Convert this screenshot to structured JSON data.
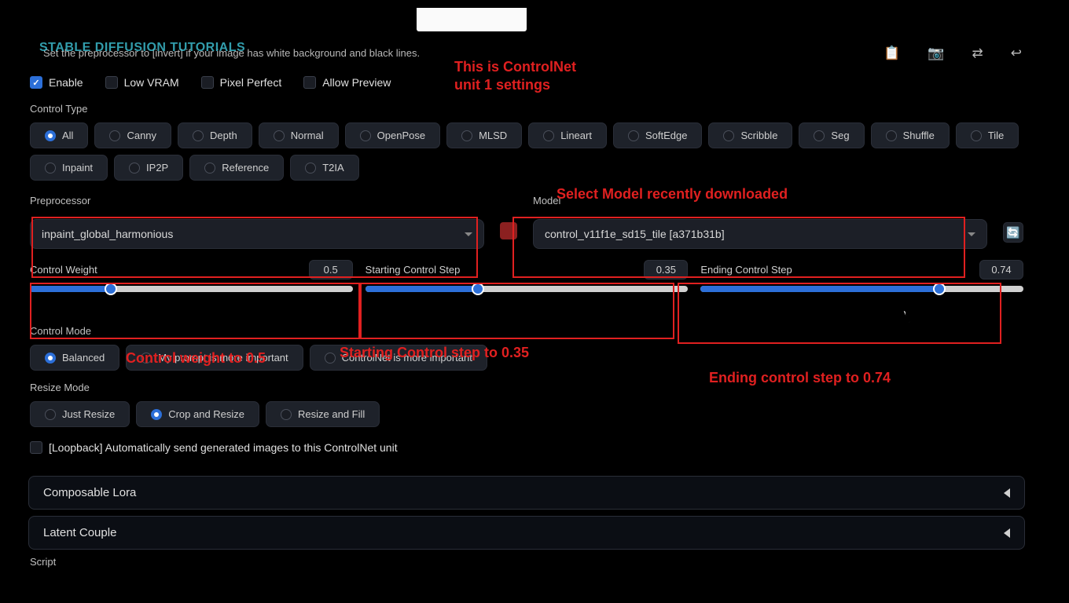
{
  "watermark": "STABLE DIFFUSION TUTORIALS",
  "instruction_text": "Set the preprocessor to [invert] if your image has white background and black lines.",
  "checkboxes": {
    "enable": "Enable",
    "low_vram": "Low VRAM",
    "pixel_perfect": "Pixel Perfect",
    "allow_preview": "Allow Preview"
  },
  "control_type": {
    "label": "Control Type",
    "options": [
      "All",
      "Canny",
      "Depth",
      "Normal",
      "OpenPose",
      "MLSD",
      "Lineart",
      "SoftEdge",
      "Scribble",
      "Seg",
      "Shuffle",
      "Tile",
      "Inpaint",
      "IP2P",
      "Reference",
      "T2IA"
    ],
    "selected": "All"
  },
  "preprocessor": {
    "label": "Preprocessor",
    "value": "inpaint_global_harmonious"
  },
  "model": {
    "label": "Model",
    "value": "control_v11f1e_sd15_tile [a371b31b]"
  },
  "sliders": {
    "control_weight": {
      "label": "Control Weight",
      "value": "0.5",
      "percent": 25
    },
    "starting_step": {
      "label": "Starting Control Step",
      "value": "0.35",
      "percent": 35
    },
    "ending_step": {
      "label": "Ending Control Step",
      "value": "0.74",
      "percent": 74
    }
  },
  "control_mode": {
    "label": "Control Mode",
    "options": [
      "Balanced",
      "My prompt is more important",
      "ControlNet is more important"
    ],
    "selected": "Balanced"
  },
  "resize_mode": {
    "label": "Resize Mode",
    "options": [
      "Just Resize",
      "Crop and Resize",
      "Resize and Fill"
    ],
    "selected": "Crop and Resize"
  },
  "loopback": "[Loopback] Automatically send generated images to this ControlNet unit",
  "accordions": {
    "composable_lora": "Composable Lora",
    "latent_couple": "Latent Couple"
  },
  "script_label": "Script",
  "annotations": {
    "title": "This is ControlNet\nunit 1 settings",
    "model_note": "Select Model recently downloaded",
    "weight_note": "Control weight to 0.5",
    "start_note": "Starting  Control step to 0.35",
    "end_note": "Ending control step to 0.74"
  }
}
